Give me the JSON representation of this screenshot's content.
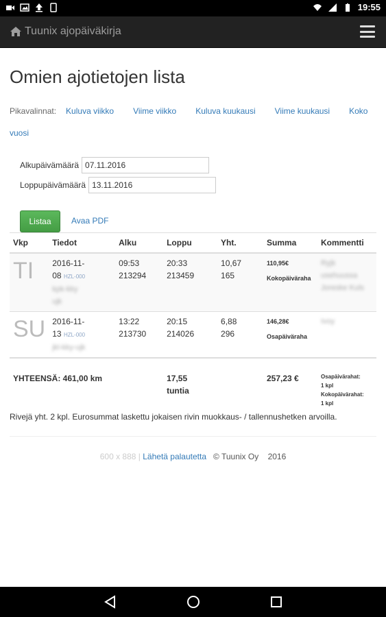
{
  "status": {
    "time": "19:55"
  },
  "navbar": {
    "brand": "Tuunix ajopäiväkirja"
  },
  "page_title": "Omien ajotietojen lista",
  "quick": {
    "label": "Pikavalinnat:",
    "links": [
      "Kuluva viikko",
      "Viime viikko",
      "Kuluva kuukausi",
      "Viime kuukausi",
      "Koko vuosi"
    ]
  },
  "form": {
    "start_label": "Alkupäivämäärä",
    "start_value": "07.11.2016",
    "end_label": "Loppupäivämäärä",
    "end_value": "13.11.2016",
    "list_button": "Listaa",
    "pdf_link": "Avaa PDF"
  },
  "table": {
    "headers": [
      "Vkp",
      "Tiedot",
      "Alku",
      "Loppu",
      "Yht.",
      "Summa",
      "Kommentti"
    ],
    "rows": [
      {
        "day": "TI",
        "date1": "2016-11-",
        "date2": "08",
        "reg": "HZL-000",
        "blur1": "kpk-kky",
        "blur2": "ujk",
        "start_time": "09:53",
        "start_km": "213294",
        "end_time": "20:33",
        "end_km": "213459",
        "total_h": "10,67",
        "total_km": "165",
        "sum": "110,95€",
        "sum_type": "Kokopäiväraha",
        "comment1": "Ryjk",
        "comment2": "usehuussa",
        "comment3": "Joreske Kuls"
      },
      {
        "day": "SU",
        "date1": "2016-11-",
        "date2": "13",
        "reg": "HZL-000",
        "blur1": "jkl-kky-ujk",
        "blur2": "",
        "start_time": "13:22",
        "start_km": "213730",
        "end_time": "20:15",
        "end_km": "214026",
        "total_h": "6,88",
        "total_km": "296",
        "sum": "146,28€",
        "sum_type": "Osapäiväraha",
        "comment1": "Ivoy",
        "comment2": "",
        "comment3": ""
      }
    ],
    "total": {
      "label": "YHTEENSÄ: 461,00 km",
      "hours": "17,55",
      "hours_unit": "tuntia",
      "sum": "257,23 €",
      "part_label": "Osapäivärahat:",
      "part_count": "1 kpl",
      "full_label": "Kokopäivärahat:",
      "full_count": "1 kpl"
    }
  },
  "note": "Rivejä yht. 2 kpl. Eurosummat laskettu jokaisen rivin muokkaus- / tallennushetken arvoilla.",
  "footer": {
    "size": "600 x 888",
    "separator": "|",
    "feedback": "Lähetä palautetta",
    "copyright": "© Tuunix Oy",
    "year": "2016"
  }
}
